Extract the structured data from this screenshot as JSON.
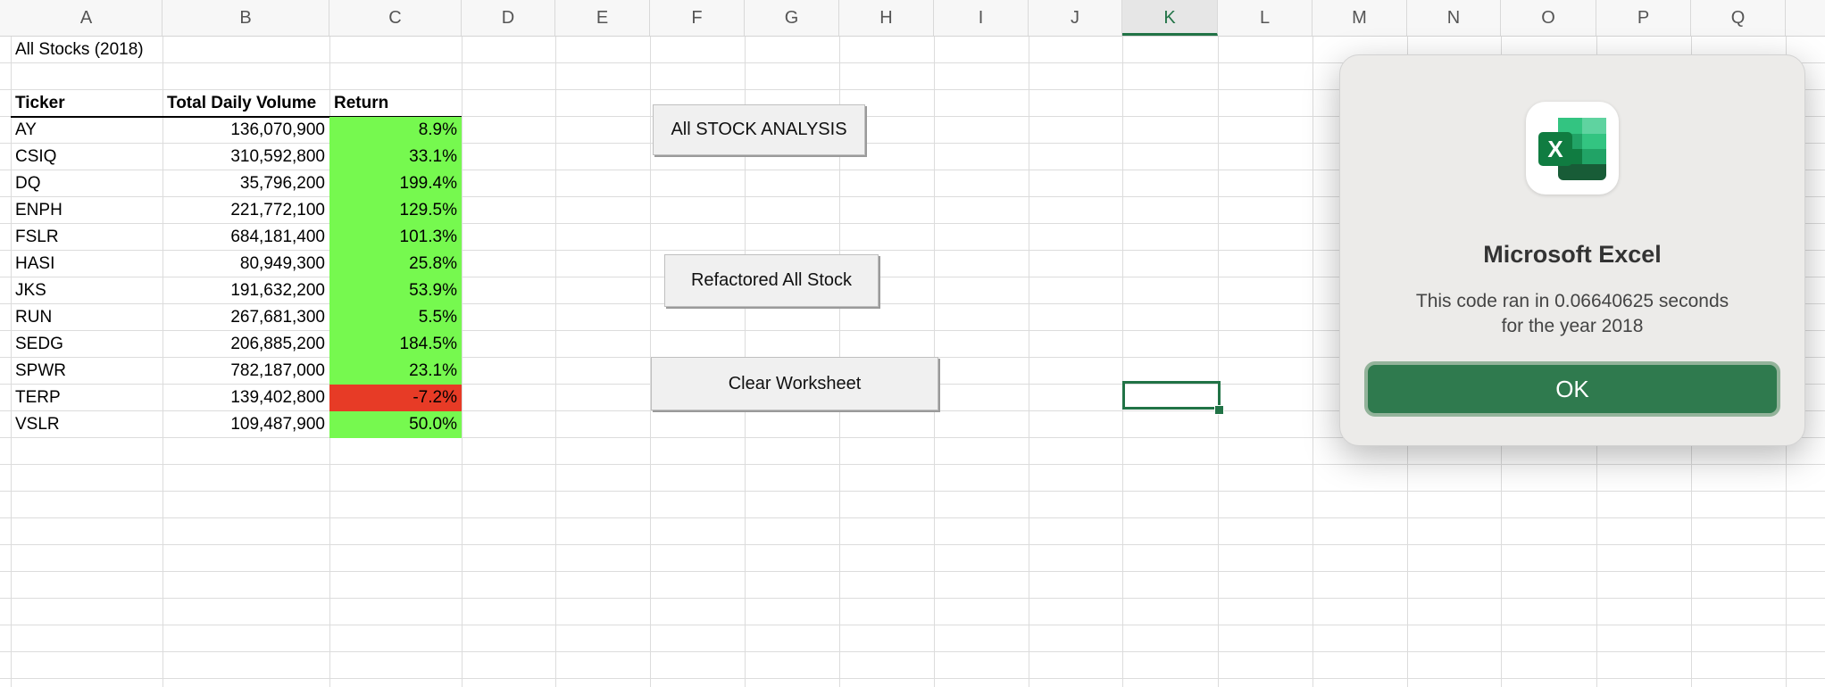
{
  "sheet": {
    "columns": [
      "A",
      "B",
      "C",
      "D",
      "E",
      "F",
      "G",
      "H",
      "I",
      "J",
      "K",
      "L",
      "M",
      "N",
      "O",
      "P",
      "Q"
    ],
    "active_column": "K",
    "title_cell": "All Stocks (2018)",
    "headers": [
      "Ticker",
      "Total Daily Volume",
      "Return"
    ],
    "rows": [
      {
        "ticker": "AY",
        "volume": "136,070,900",
        "ret": "8.9%",
        "positive": true
      },
      {
        "ticker": "CSIQ",
        "volume": "310,592,800",
        "ret": "33.1%",
        "positive": true
      },
      {
        "ticker": "DQ",
        "volume": "35,796,200",
        "ret": "199.4%",
        "positive": true
      },
      {
        "ticker": "ENPH",
        "volume": "221,772,100",
        "ret": "129.5%",
        "positive": true
      },
      {
        "ticker": "FSLR",
        "volume": "684,181,400",
        "ret": "101.3%",
        "positive": true
      },
      {
        "ticker": "HASI",
        "volume": "80,949,300",
        "ret": "25.8%",
        "positive": true
      },
      {
        "ticker": "JKS",
        "volume": "191,632,200",
        "ret": "53.9%",
        "positive": true
      },
      {
        "ticker": "RUN",
        "volume": "267,681,300",
        "ret": "5.5%",
        "positive": true
      },
      {
        "ticker": "SEDG",
        "volume": "206,885,200",
        "ret": "184.5%",
        "positive": true
      },
      {
        "ticker": "SPWR",
        "volume": "782,187,000",
        "ret": "23.1%",
        "positive": true
      },
      {
        "ticker": "TERP",
        "volume": "139,402,800",
        "ret": "-7.2%",
        "positive": false
      },
      {
        "ticker": "VSLR",
        "volume": "109,487,900",
        "ret": "50.0%",
        "positive": true
      }
    ]
  },
  "buttons": {
    "all_stock_analysis": "All STOCK ANALYSIS",
    "refactored_all_stock": "Refactored All Stock",
    "clear_worksheet": "Clear Worksheet"
  },
  "dialog": {
    "title": "Microsoft Excel",
    "message_line1": "This code ran in 0.06640625 seconds",
    "message_line2": "for the year 2018",
    "ok_label": "OK",
    "icon": "excel-app-icon",
    "icon_letter": "X"
  },
  "colors": {
    "positive": "#76f94f",
    "negative": "#e73b26",
    "accent": "#217346",
    "ok_button": "#2f7a4e"
  }
}
